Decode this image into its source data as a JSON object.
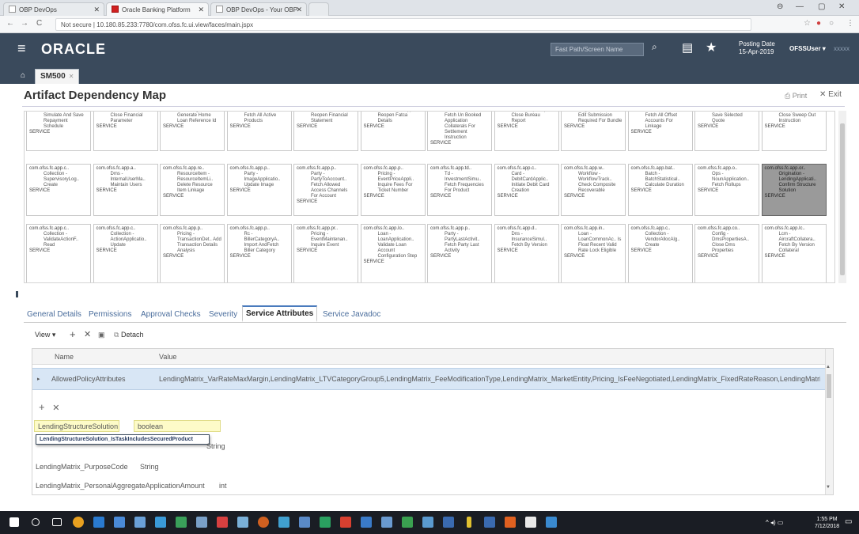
{
  "browser": {
    "tabs": [
      {
        "label": "OBP DevOps",
        "active": false
      },
      {
        "label": "Oracle Banking Platform",
        "active": true
      },
      {
        "label": "OBP DevOps - Your OBP",
        "active": false
      }
    ],
    "url": "Not secure  |  10.180.85.233:7780/com.ofss.fc.ui.view/faces/main.jspx"
  },
  "header": {
    "logo": "ORACLE",
    "fastpath_placeholder": "Fast Path/Screen Name",
    "posting_label": "Posting Date",
    "posting_date": "15-Apr-2019",
    "user": "OFSSUser",
    "user_more": "xxxxx"
  },
  "subtabs": {
    "active": "SM500"
  },
  "page": {
    "title": "Artifact Dependency Map",
    "print": "Print",
    "exit": "Exit"
  },
  "grid": {
    "row1": [
      {
        "desc": "LoanScheduleUi.. Simulate And Save Repayment Schedule",
        "type": "SERVICE"
      },
      {
        "desc": "FinancialParam.. Close Financial Parameter",
        "type": "SERVICE"
      },
      {
        "desc": "BorrowingPower.. Generate Home Loan Reference Id",
        "type": "SERVICE"
      },
      {
        "desc": "ProductManufac.. Fetch All Active Products",
        "type": "SERVICE"
      },
      {
        "desc": "FinancialStatem.. Reopen Financial Statement",
        "type": "SERVICE"
      },
      {
        "desc": "FatcaDetailsApp.. Reopen Fatca Details",
        "type": "SERVICE"
      },
      {
        "desc": "CollateralSettle.. Fetch Un Booked Application Collaterals For Settlement Instruction",
        "type": "SERVICE"
      },
      {
        "desc": "BureauReportAp.. Close Bureau Report",
        "type": "SERVICE"
      },
      {
        "desc": "OriginationBund.. Is Edit Submission Required For Bundle",
        "type": "SERVICE"
      },
      {
        "desc": "DDAOffsetAccou.. Fetch All Offset Accounts For Linkage",
        "type": "SERVICE"
      },
      {
        "desc": "PropertyInsuran.. Save Selected Quote",
        "type": "SERVICE"
      },
      {
        "desc": "SweepOutInstru.. Close Sweep Out Instruction",
        "type": "SERVICE"
      }
    ],
    "row2": [
      {
        "id": "com.ofss.fc.app.c..",
        "desc": "Collection - SupervisoryLog.. Create",
        "type": "SERVICE"
      },
      {
        "id": "com.ofss.fc.app.a..",
        "desc": "Dms - InternalUserMa.. Maintain Users",
        "type": "SERVICE"
      },
      {
        "id": "com.ofss.fc.app.re..",
        "desc": "ResourceItem - ResourceItemLi.. Delete Resource Item Linkage",
        "type": "SERVICE"
      },
      {
        "id": "com.ofss.fc.app.p..",
        "desc": "Party - ImageApplicatio.. Update Image",
        "type": "SERVICE"
      },
      {
        "id": "com.ofss.fc.app.p..",
        "desc": "Party - PartyToAccount.. Fetch Allowed Access Channels For Account",
        "type": "SERVICE"
      },
      {
        "id": "com.ofss.fc.app.p..",
        "desc": "Pricing - EventPriceAppli.. Inquire Fees For Ticket Number",
        "type": "SERVICE"
      },
      {
        "id": "com.ofss.fc.app.td..",
        "desc": "Td - InvestmentSimu.. Fetch Frequencies For Product",
        "type": "SERVICE"
      },
      {
        "id": "com.ofss.fc.app.c..",
        "desc": "Card - DebitCardApplic.. Initiate Debit Card Creation",
        "type": "SERVICE"
      },
      {
        "id": "com.ofss.fc.app.w..",
        "desc": "Workflow - WorkflowTrack.. Check Composite Recoverable",
        "type": "SERVICE"
      },
      {
        "id": "com.ofss.fc.app.bat..",
        "desc": "Batch - BatchStatistical.. Calculate Duration",
        "type": "SERVICE"
      },
      {
        "id": "com.ofss.fc.app.o..",
        "desc": "Ops - NounApplication.. Fetch Rollups",
        "type": "SERVICE"
      },
      {
        "id": "com.ofss.fc.app.or..",
        "desc": "Origination - LendingApplicati.. Confirm Structure Solution",
        "type": "SERVICE",
        "selected": true
      }
    ],
    "row3": [
      {
        "id": "com.ofss.fc.app.c..",
        "desc": "Collection - ValidateActionF.. Read",
        "type": "SERVICE"
      },
      {
        "id": "com.ofss.fc.app.c..",
        "desc": "Collection - ActionApplicatio.. Update",
        "type": "SERVICE"
      },
      {
        "id": "com.ofss.fc.app.p..",
        "desc": "Pricing - TransactionDet.. Add Transaction Details Analysis",
        "type": "SERVICE"
      },
      {
        "id": "com.ofss.fc.app.p..",
        "desc": "Rc - BillerCategoryA.. Import AndFetch Biller Category",
        "type": "SERVICE"
      },
      {
        "id": "com.ofss.fc.app.pr..",
        "desc": "Pricing - EventMaintenan.. Inquire Event",
        "type": "SERVICE"
      },
      {
        "id": "com.ofss.fc.app.lo..",
        "desc": "Loan - LoanApplication.. Validate Loan Account Configuration Step",
        "type": "SERVICE"
      },
      {
        "id": "com.ofss.fc.app.p..",
        "desc": "Party - PartyLastActivit.. Fetch Party Last Activity",
        "type": "SERVICE"
      },
      {
        "id": "com.ofss.fc.app.d..",
        "desc": "Dns - InsuranceSimul.. Fetch By Version",
        "type": "SERVICE"
      },
      {
        "id": "com.ofss.fc.app.in..",
        "desc": "Loan - LoanCommonAc.. Is Float Recent Valid Rate Lock Eligible",
        "type": "SERVICE"
      },
      {
        "id": "com.ofss.fc.app.c..",
        "desc": "Collection - VendorAllocAlg.. Create",
        "type": "SERVICE"
      },
      {
        "id": "com.ofss.fc.app.co..",
        "desc": "Config - DmsPropertiesA.. Close Dms Properties",
        "type": "SERVICE"
      },
      {
        "id": "com.ofss.fc.app.lc..",
        "desc": "Lcm - AircraftCollatera.. Fetch By Version Collateral",
        "type": "SERVICE"
      }
    ]
  },
  "detail_tabs": [
    "General Details",
    "Permissions",
    "Approval Checks",
    "Severity",
    "Service Attributes",
    "Service Javadoc"
  ],
  "detail_active": "Service Attributes",
  "toolbar": {
    "view": "View",
    "detach": "Detach"
  },
  "table": {
    "col_name": "Name",
    "col_value": "Value",
    "row": {
      "name": "AllowedPolicyAttributes",
      "value": "LendingMatrix_VarRateMaxMargin,LendingMatrix_LTVCategoryGroup5,LendingMatrix_FeeModificationType,LendingMatrix_MarketEntity,Pricing_IsFeeNegotiated,LendingMatrix_FixedRateReason,LendingMatrix.."
    },
    "attrs": [
      {
        "name": "LendingStructureSolution",
        "type": "boolean"
      },
      {
        "name": "LendingMatrix_PurposeCode",
        "type": "String"
      },
      {
        "name": "LendingMatrix_PersonalAggregateApplicationAmount",
        "type": "int"
      }
    ],
    "hidden_type": "String",
    "suggestion": "LendingStructureSolution_IsTaskIncludesSecuredProduct"
  },
  "taskbar": {
    "time": "1:55 PM",
    "date": "7/12/2018"
  },
  "colors": {
    "header": "#3a4a5c",
    "link": "#4a6d9c",
    "selected_row": "#d8e6f5"
  }
}
